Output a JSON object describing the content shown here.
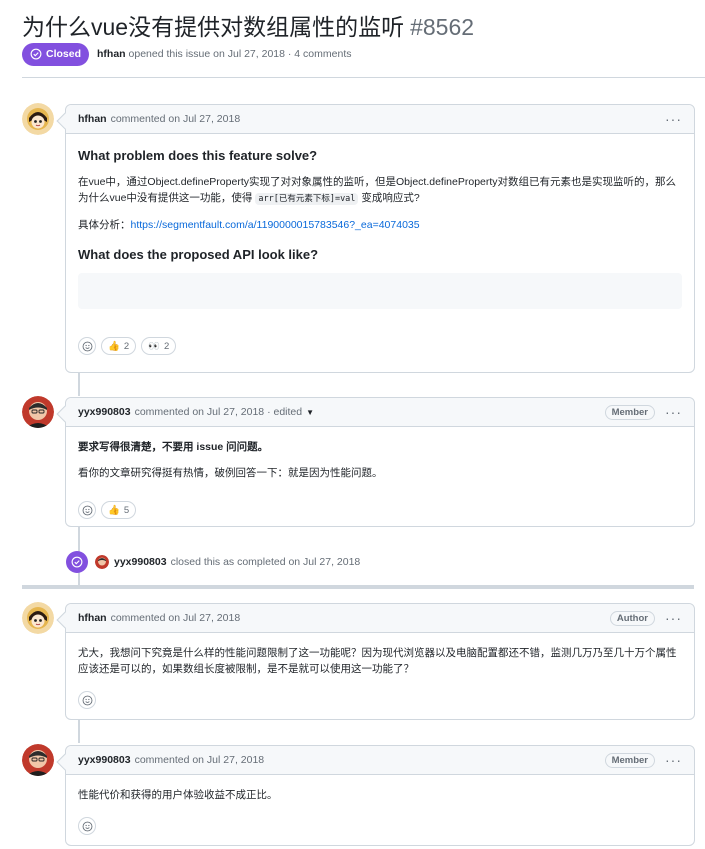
{
  "issue": {
    "title": "为什么vue没有提供对数组属性的监听",
    "number": "#8562",
    "state": "Closed",
    "author": "hfhan",
    "opened_text": "opened this issue on Jul 27, 2018 · 4 comments"
  },
  "comments": [
    {
      "author": "hfhan",
      "meta": "commented on Jul 27, 2018",
      "heading1": "What problem does this feature solve?",
      "para1_a": "在vue中，通过Object.defineProperty实现了对对象属性的监听，但是Object.defineProperty对数组已有元素也是实现监听的，那么为什么vue中没有提供这一功能，使得",
      "para1_code": "arr[已有元素下标]=val",
      "para1_b": "变成响应式?",
      "para2_label": "具体分析：",
      "para2_link": "https://segmentfault.com/a/1190000015783546?_ea=4074035",
      "heading2": "What does the proposed API look like?",
      "reactions": [
        {
          "icon": "thumbs-up-icon",
          "count": "2"
        },
        {
          "icon": "eyes-icon",
          "count": "2"
        }
      ]
    },
    {
      "author": "yyx990803",
      "meta": "commented on Jul 27, 2018 · edited",
      "label": "Member",
      "bold_text": "要求写得很清楚，不要用 issue 问问题。",
      "text": "看你的文章研究得挺有热情，破例回答一下：就是因为性能问题。",
      "reactions": [
        {
          "icon": "thumbs-up-icon",
          "count": "5"
        }
      ]
    },
    {
      "author": "hfhan",
      "meta": "commented on Jul 27, 2018",
      "label": "Author",
      "text": "尤大，我想问下究竟是什么样的性能问题限制了这一功能呢？因为现代浏览器以及电脑配置都还不错，监测几万乃至几十万个属性应该还是可以的，如果数组长度被限制，是不是就可以使用这一功能了？"
    },
    {
      "author": "yyx990803",
      "meta": "commented on Jul 27, 2018",
      "label": "Member",
      "text": "性能代价和获得的用户体验收益不成正比。"
    }
  ],
  "event": {
    "actor": "yyx990803",
    "text": "closed this as completed on Jul 27, 2018"
  },
  "colors": {
    "closed_purple": "#8250df",
    "link_blue": "#0969da",
    "border": "#d0d7de"
  }
}
